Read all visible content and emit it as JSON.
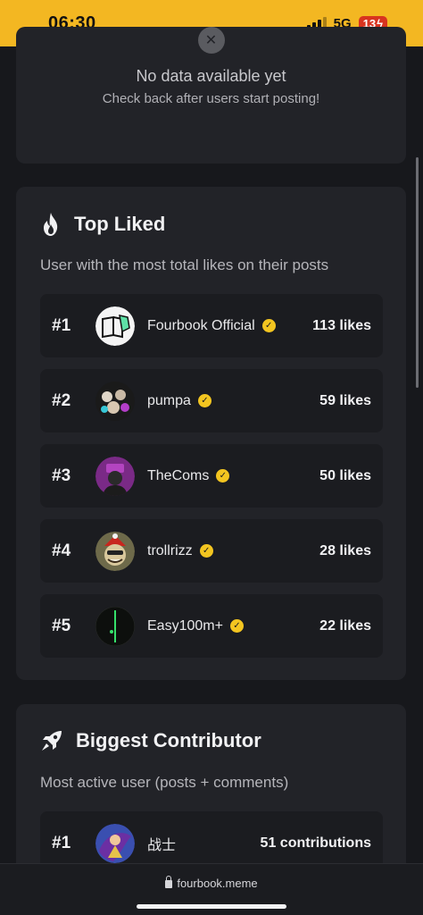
{
  "status_bar": {
    "time": "06:30",
    "network": "5G",
    "battery": "13"
  },
  "empty_state": {
    "title": "No data available yet",
    "subtitle": "Check back after users start posting!"
  },
  "top_liked": {
    "title": "Top Liked",
    "subtitle": "User with the most total likes on their posts",
    "rows": [
      {
        "rank": "#1",
        "name": "Fourbook Official",
        "score": "113 likes"
      },
      {
        "rank": "#2",
        "name": "pumpa",
        "score": "59 likes"
      },
      {
        "rank": "#3",
        "name": "TheComs",
        "score": "50 likes"
      },
      {
        "rank": "#4",
        "name": "trollrizz",
        "score": "28 likes"
      },
      {
        "rank": "#5",
        "name": "Easy100m+",
        "score": "22 likes"
      }
    ]
  },
  "biggest_contributor": {
    "title": "Biggest Contributor",
    "subtitle": "Most active user (posts + comments)",
    "rows": [
      {
        "rank": "#1",
        "name": "战士",
        "score": "51 contributions"
      }
    ]
  },
  "browser": {
    "url": "fourbook.meme"
  },
  "colors": {
    "accent": "#f3b722",
    "verified": "#f3c520",
    "card": "#222328",
    "row": "#1b1c20"
  }
}
